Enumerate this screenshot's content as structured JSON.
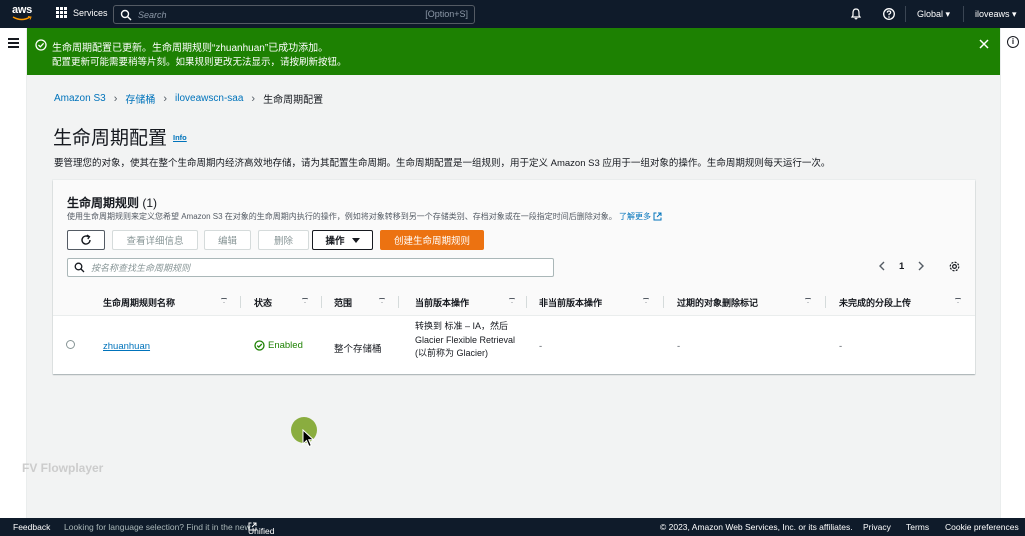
{
  "nav": {
    "logo": "aws",
    "services": "Services",
    "search_placeholder": "Search",
    "search_shortcut": "[Option+S]",
    "region": "Global",
    "user": "iloveaws"
  },
  "flash": {
    "title": "生命周期配置已更新。生命周期规则“zhuanhuan”已成功添加。",
    "description": "配置更新可能需要稍等片刻。如果规则更改无法显示，请按刷新按钮。"
  },
  "breadcrumb": {
    "items": [
      "Amazon S3",
      "存储桶",
      "iloveawscn-saa"
    ],
    "current": "生命周期配置"
  },
  "page": {
    "title": "生命周期配置",
    "info": "Info",
    "description": "要管理您的对象，使其在整个生命周期内经济高效地存储，请为其配置生命周期。生命周期配置是一组规则，用于定义 Amazon S3 应用于一组对象的操作。生命周期规则每天运行一次。"
  },
  "panel": {
    "title": "生命周期规则",
    "count": "(1)",
    "description": "使用生命周期规则来定义您希望 Amazon S3 在对象的生命周期内执行的操作，例如将对象转移到另一个存储类别、存档对象或在一段指定时间后删除对象。",
    "learn_more": "了解更多",
    "buttons": {
      "view": "查看详细信息",
      "edit": "编辑",
      "delete": "删除",
      "actions": "操作",
      "create": "创建生命周期规则"
    },
    "filter_placeholder": "按名称查找生命周期规则",
    "page_number": "1"
  },
  "table": {
    "headers": [
      "生命周期规则名称",
      "状态",
      "范围",
      "当前版本操作",
      "非当前版本操作",
      "过期的对象删除标记",
      "未完成的分段上传"
    ],
    "rows": [
      {
        "name": "zhuanhuan",
        "status": "Enabled",
        "scope": "整个存储桶",
        "current_action": "转换到 标准 – IA，然后 Glacier Flexible Retrieval (以前称为 Glacier)",
        "noncurrent_action": "-",
        "expired_marker": "-",
        "incomplete_upload": "-"
      }
    ]
  },
  "watermark": "FV Flowplayer",
  "footer": {
    "feedback": "Feedback",
    "language_note": "Looking for language selection? Find it in the new",
    "unified_settings": "Unified Settings",
    "copyright": "© 2023, Amazon Web Services, Inc. or its affiliates.",
    "privacy": "Privacy",
    "terms": "Terms",
    "cookies": "Cookie preferences"
  },
  "colors": {
    "nav_bg": "#0f1b2a",
    "flash_success": "#1d8102",
    "link": "#0073bb",
    "primary_button": "#ec7211"
  }
}
